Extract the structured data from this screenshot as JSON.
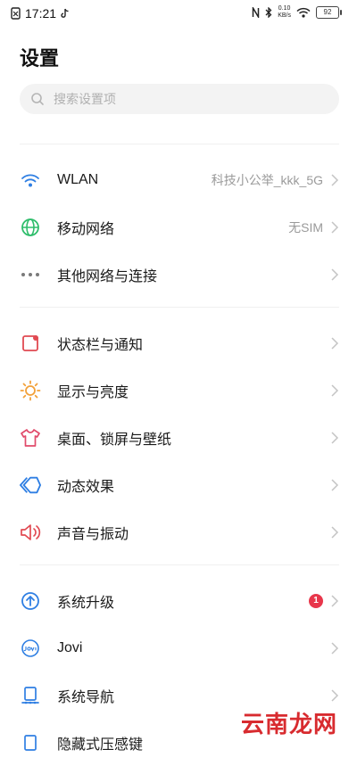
{
  "status_bar": {
    "time": "17:21",
    "speed_value": "0.10",
    "speed_unit": "KB/s",
    "battery": "92"
  },
  "page_title": "设置",
  "search": {
    "placeholder": "搜索设置项"
  },
  "settings": [
    {
      "label": "WLAN",
      "value": "科技小公举_kkk_5G",
      "icon": "wifi-icon"
    },
    {
      "label": "移动网络",
      "value": "无SIM",
      "icon": "globe-icon"
    },
    {
      "label": "其他网络与连接",
      "icon": "more-dots-icon"
    },
    {
      "label": "状态栏与通知",
      "icon": "notification-icon"
    },
    {
      "label": "显示与亮度",
      "icon": "sun-icon"
    },
    {
      "label": "桌面、锁屏与壁纸",
      "icon": "shirt-icon"
    },
    {
      "label": "动态效果",
      "icon": "motion-icon"
    },
    {
      "label": "声音与振动",
      "icon": "speaker-icon"
    },
    {
      "label": "系统升级",
      "badge": "1",
      "icon": "upgrade-icon"
    },
    {
      "label": "Jovi",
      "icon": "jovi-icon"
    },
    {
      "label": "系统导航",
      "icon": "navigation-icon"
    },
    {
      "label": "隐藏式压感键",
      "icon": "pressure-key-icon"
    }
  ],
  "watermark": "云南龙网",
  "colors": {
    "accent_blue": "#2f7fe3",
    "green": "#2ebd6b",
    "red": "#e14a52",
    "orange": "#f2a13a",
    "badge": "#e8364b"
  }
}
